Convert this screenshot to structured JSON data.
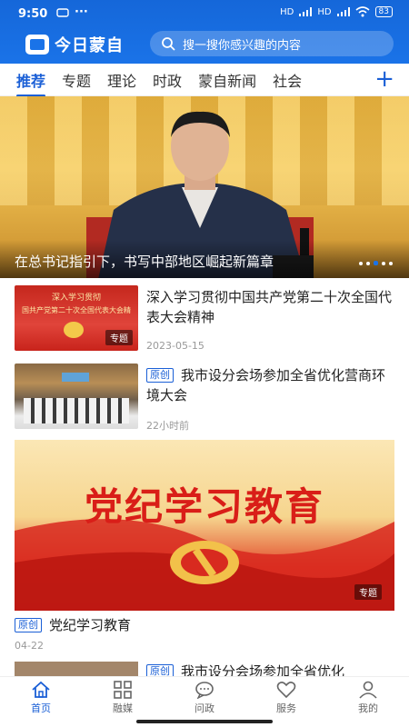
{
  "status": {
    "time": "9:50",
    "battery": "83",
    "network": "HD"
  },
  "header": {
    "app_name": "今日蒙自",
    "search_placeholder": "搜一搜你感兴趣的内容"
  },
  "tabs": [
    {
      "label": "推荐",
      "active": true
    },
    {
      "label": "专题"
    },
    {
      "label": "理论"
    },
    {
      "label": "时政"
    },
    {
      "label": "蒙自新闻"
    },
    {
      "label": "社会"
    }
  ],
  "tab_add_icon": "plus-icon",
  "hero": {
    "caption": "在总书记指引下，书写中部地区崛起新篇章",
    "dots_total": 5,
    "dots_active": 3
  },
  "news": [
    {
      "thumb_text_1": "深入学习贯彻",
      "thumb_text_2": "国共产党第二十次全国代表大会精",
      "tag": "专题",
      "title": "深入学习贯彻中国共产党第二十次全国代表大会精神",
      "date": "2023-05-15"
    },
    {
      "badge": "原创",
      "title": "我市设分会场参加全省优化营商环境大会",
      "date": "22小时前"
    }
  ],
  "big_card": {
    "banner_title": "党纪学习教育",
    "tag": "专题",
    "badge": "原创",
    "caption": "党纪学习教育",
    "date": "04-22"
  },
  "partial_item": {
    "badge": "原创",
    "title": "我市设分会场参加全省优化"
  },
  "nav": [
    {
      "label": "首页",
      "icon": "home-icon",
      "active": true
    },
    {
      "label": "融媒",
      "icon": "grid-icon"
    },
    {
      "label": "问政",
      "icon": "chat-icon"
    },
    {
      "label": "服务",
      "icon": "heart-icon"
    },
    {
      "label": "我的",
      "icon": "user-icon"
    }
  ],
  "colors": {
    "primary": "#1a73e8",
    "accent": "#1a5fd6",
    "red": "#d91e18"
  }
}
